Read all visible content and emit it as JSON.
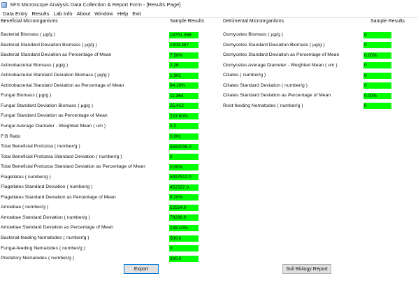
{
  "window": {
    "title": "SFS Microscope Analysis Data Collection & Report Form - [Results Page]"
  },
  "menu": [
    "Data Entry",
    "Results",
    "Lab Info",
    "About",
    "Window",
    "Help",
    "Exit"
  ],
  "left": {
    "header": "Beneficial Microorganisms",
    "results_header": "Sample Results",
    "rows": [
      {
        "label": "Bacterial Biomass ( µg/g )",
        "value": "18751.068"
      },
      {
        "label": "Bacterial Standard Deviation Biomass ( µg/g )",
        "value": "1409.367"
      },
      {
        "label": "Bacterial Standard Deviation as Percentage of Mean",
        "value": "7.50%"
      },
      {
        "label": "Actinobacterial Biomass ( µg/g )",
        "value": "2.26"
      },
      {
        "label": "Actinobacterial Standard Deviation Biomass ( µg/g )",
        "value": "1.901"
      },
      {
        "label": "Actinobacterial Standard Deviation as Percentage of Mean",
        "value": "84.10%"
      },
      {
        "label": "Fungal Biomass ( µg/g )",
        "value": "11.364"
      },
      {
        "label": "Fungal Standard Deviation Biomass ( µg/g )",
        "value": "25.412"
      },
      {
        "label": "Fungal Standard Deviation as Percentage of Mean",
        "value": "223.60%"
      },
      {
        "label": "Fungal Average Diameter - Weighted Mean ( um )",
        "value": "5.0"
      },
      {
        "label": "F:B Ratio",
        "value": "0.001"
      },
      {
        "label": "Total Beneficial Protozoa ( number/g )",
        "value": "5550036.0"
      },
      {
        "label": "Total Beneficial Protozoa Standard Deviation ( number/g )",
        "value": "0"
      },
      {
        "label": "Total Beneficial Protozoa Standard Deviation as Percentage of Mean",
        "value": "0.00%"
      },
      {
        "label": "Flagellates ( number/g )",
        "value": "5497512.0"
      },
      {
        "label": "Flagellates Standard Deviation ( number/g )",
        "value": "452337.0"
      },
      {
        "label": "Flagellates Standard Deviation as Percentage of Mean",
        "value": "8.20%"
      },
      {
        "label": "Amoebae ( number/g )",
        "value": "52524.0"
      },
      {
        "label": "Amoebae Standard Deviation ( number/g )",
        "value": "78298.0"
      },
      {
        "label": "Amoebae Standard Deviation as Percentage of Mean",
        "value": "149.10%"
      },
      {
        "label": "Bacterial-feeding Nematodes ( number/g )",
        "value": "500.0"
      },
      {
        "label": "Fungal-feeding Nematodes ( number/g )",
        "value": "0"
      },
      {
        "label": "Predatory Nematodes ( number/g )",
        "value": "300.0"
      }
    ]
  },
  "right": {
    "header": "Detrimental Microorganisms",
    "results_header": "Sample Results",
    "rows": [
      {
        "label": "Oomycetes Biomass ( µg/g )",
        "value": "0"
      },
      {
        "label": "Oomycetes Standard Deviation Biomass ( µg/g )",
        "value": "0"
      },
      {
        "label": "Oomycetes Standard Deviation as Percentage of Mean",
        "value": "0.00%"
      },
      {
        "label": "Oomycetes Average Diameter - Weighted Mean ( um )",
        "value": "0"
      },
      {
        "label": "Ciliates ( number/g )",
        "value": "0"
      },
      {
        "label": "Ciliates Standard Deviation ( number/g )",
        "value": "0"
      },
      {
        "label": "Ciliates Standard Deviation as Percentage of Mean",
        "value": "0.00%"
      },
      {
        "label": "Root-feeding Nematodes ( number/g )",
        "value": "0"
      }
    ]
  },
  "buttons": {
    "export": "Export",
    "report": "Soil Biology Report"
  },
  "colors": {
    "value_fill": "#00ff00"
  }
}
